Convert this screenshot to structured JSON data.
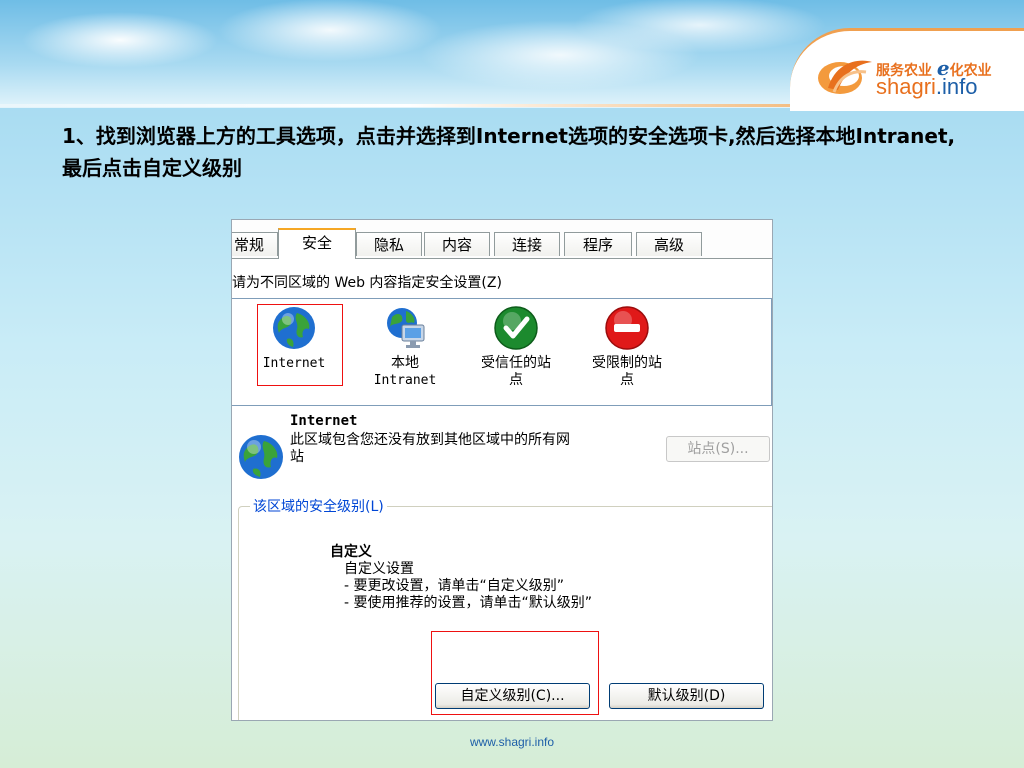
{
  "brand": {
    "slogan_left": "服务农业",
    "slogan_e": "e",
    "slogan_right": "化农业",
    "site_main": "shagri",
    "site_tld": ".info"
  },
  "instruction": "1、找到浏览器上方的工具选项，点击并选择到Internet选项的安全选项卡,然后选择本地Intranet,最后点击自定义级别",
  "dialog": {
    "tabs": [
      "常规",
      "安全",
      "隐私",
      "内容",
      "连接",
      "程序",
      "高级"
    ],
    "active_tab": "安全",
    "zone_caption": "请为不同区域的 Web 内容指定安全设置(Z)",
    "zones": [
      {
        "label": "Internet"
      },
      {
        "label_1": "本地",
        "label_2": "Intranet"
      },
      {
        "label_1": "受信任的站",
        "label_2": "点"
      },
      {
        "label_1": "受限制的站",
        "label_2": "点"
      }
    ],
    "selected_zone_title": "Internet",
    "selected_zone_desc": "此区域包含您还没有放到其他区域中的所有网站",
    "sites_button": "站点(S)...",
    "level_group_label": "该区域的安全级别(L)",
    "level_title": "自定义",
    "level_lines": [
      "自定义设置",
      "- 要更改设置，请单击“自定义级别”",
      "- 要使用推荐的设置，请单击“默认级别”"
    ],
    "custom_level_button": "自定义级别(C)...",
    "default_level_button": "默认级别(D)"
  },
  "footer": "www.shagri.info",
  "colors": {
    "highlight": "#ee1111",
    "brand_orange": "#e8701e",
    "brand_blue": "#1d5fa8",
    "group_label": "#0046d5"
  }
}
